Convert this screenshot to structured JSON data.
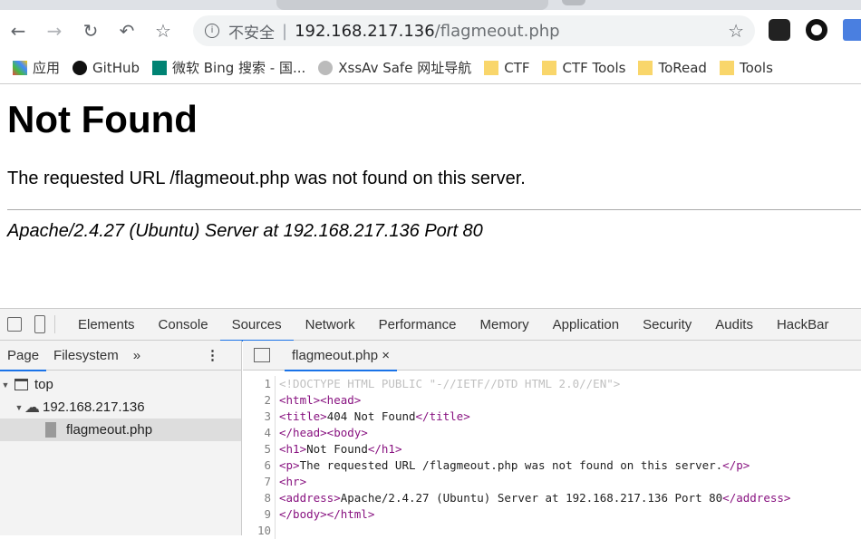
{
  "browser": {
    "address": {
      "insecure_label": "不安全",
      "host": "192.168.217.136",
      "path": "/flagmeout.php",
      "info_icon": "info-icon",
      "star_icon": "star-icon"
    },
    "bookmarks": [
      {
        "label": "应用",
        "icon": "apps-icon"
      },
      {
        "label": "GitHub",
        "icon": "github-icon"
      },
      {
        "label": "微软 Bing 搜索 - 国...",
        "icon": "bing-icon"
      },
      {
        "label": "XssAv Safe 网址导航",
        "icon": "alien-icon"
      },
      {
        "label": "CTF",
        "icon": "folder-icon"
      },
      {
        "label": "CTF Tools",
        "icon": "folder-icon"
      },
      {
        "label": "ToRead",
        "icon": "folder-icon"
      },
      {
        "label": "Tools",
        "icon": "folder-icon"
      }
    ]
  },
  "page": {
    "heading": "Not Found",
    "message": "The requested URL /flagmeout.php was not found on this server.",
    "address": "Apache/2.4.27 (Ubuntu) Server at 192.168.217.136 Port 80"
  },
  "devtools": {
    "tabs": [
      "Elements",
      "Console",
      "Sources",
      "Network",
      "Performance",
      "Memory",
      "Application",
      "Security",
      "Audits",
      "HackBar"
    ],
    "active_tab": "Sources",
    "navigator": {
      "tabs": [
        "Page",
        "Filesystem"
      ],
      "more": "»",
      "menu": "⋮",
      "tree": {
        "top": "top",
        "host": "192.168.217.136",
        "file": "flagmeout.php"
      }
    },
    "editor": {
      "file_tab": "flagmeout.php",
      "close": "×",
      "lines": [
        [
          [
            "doc",
            "<!DOCTYPE HTML PUBLIC \"-//IETF//DTD HTML 2.0//EN\">"
          ]
        ],
        [
          [
            "tag",
            "<html><head>"
          ]
        ],
        [
          [
            "tag",
            "<title>"
          ],
          [
            "txt",
            "404 Not Found"
          ],
          [
            "tag",
            "</title>"
          ]
        ],
        [
          [
            "tag",
            "</head><body>"
          ]
        ],
        [
          [
            "tag",
            "<h1>"
          ],
          [
            "txt",
            "Not Found"
          ],
          [
            "tag",
            "</h1>"
          ]
        ],
        [
          [
            "tag",
            "<p>"
          ],
          [
            "txt",
            "The requested URL /flagmeout.php was not found on this server."
          ],
          [
            "tag",
            "</p>"
          ]
        ],
        [
          [
            "tag",
            "<hr>"
          ]
        ],
        [
          [
            "tag",
            "<address>"
          ],
          [
            "txt",
            "Apache/2.4.27 (Ubuntu) Server at 192.168.217.136 Port 80"
          ],
          [
            "tag",
            "</address>"
          ]
        ],
        [
          [
            "tag",
            "</body></html>"
          ]
        ],
        []
      ]
    },
    "colors": {
      "accent": "#1a73e8",
      "tag": "#881280"
    }
  }
}
